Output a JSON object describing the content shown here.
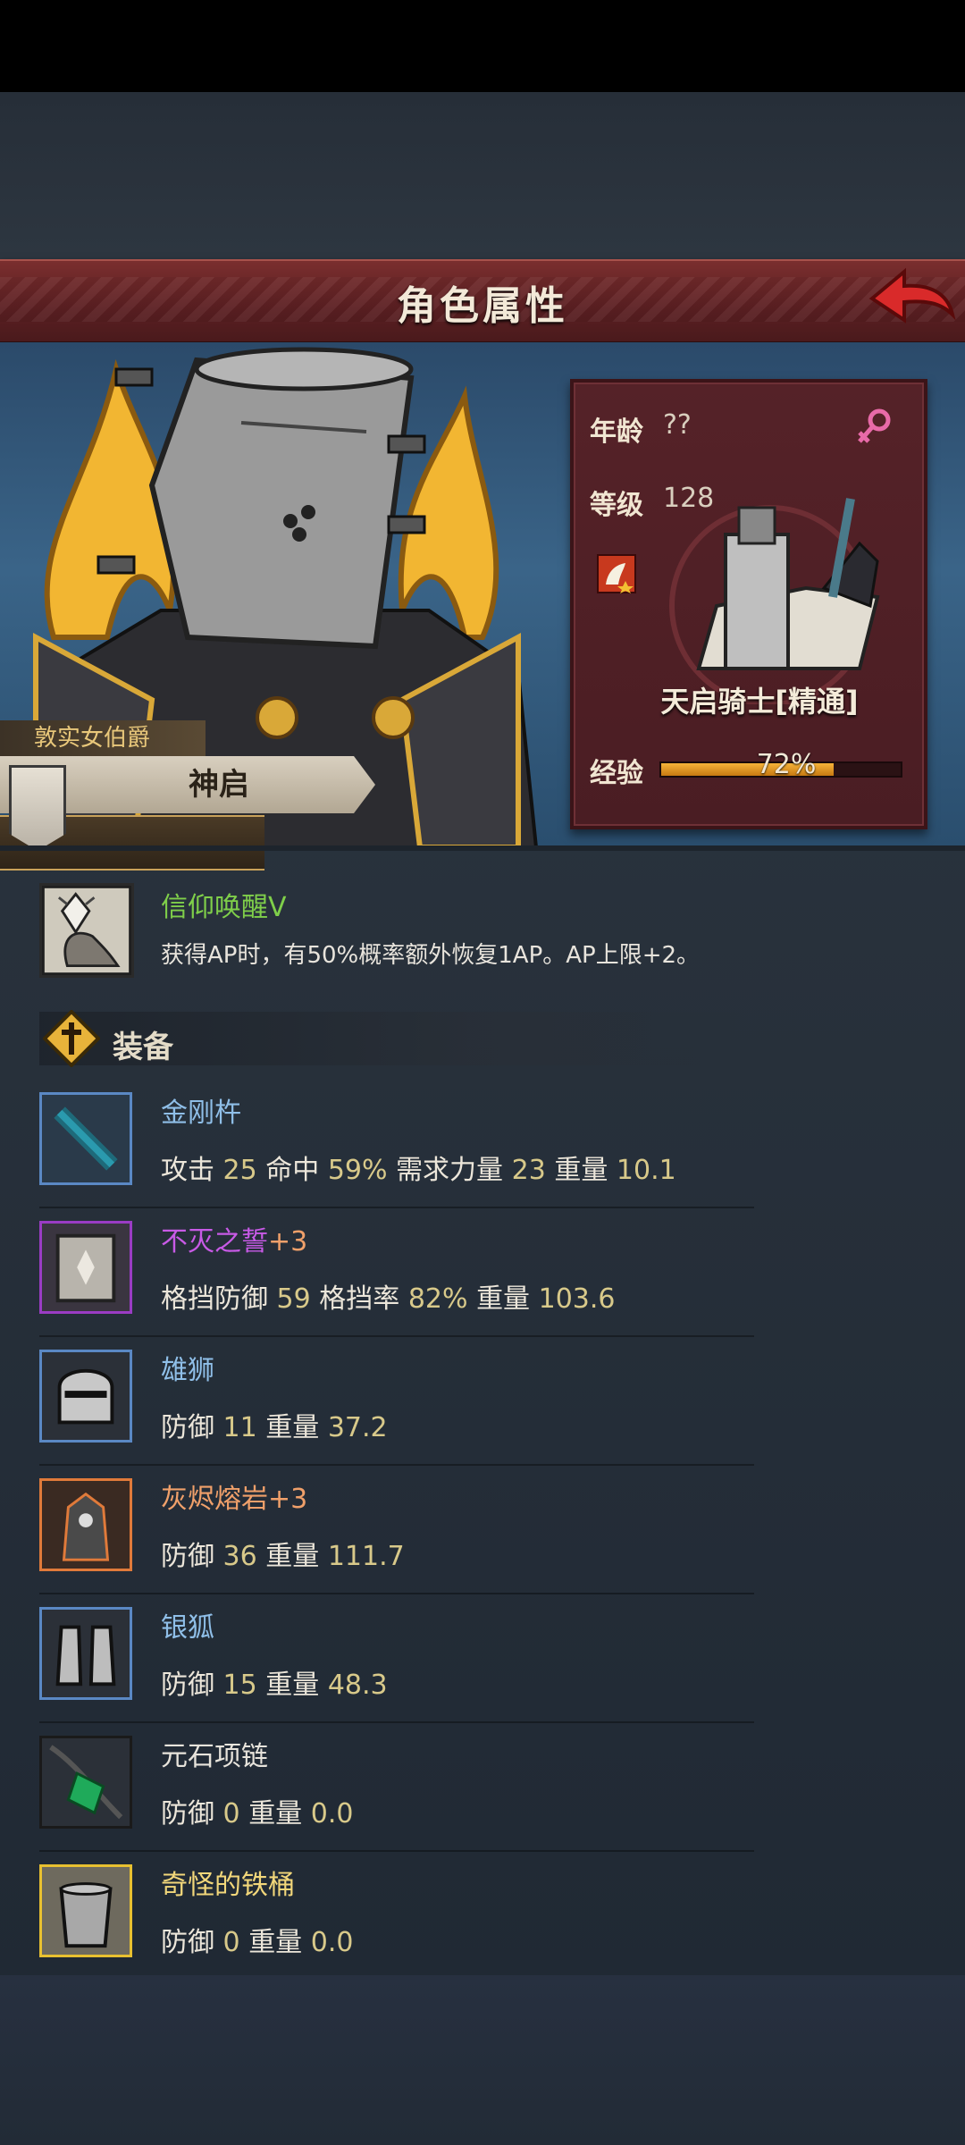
{
  "header": {
    "title": "角色属性",
    "back_icon": "back-arrow-icon"
  },
  "character": {
    "title": "敦实女伯爵",
    "name": "神启",
    "age_label": "年龄",
    "age_value": "??",
    "gender_icon": "female-icon",
    "level_label": "等级",
    "level_value": "128",
    "class_name": "天启骑士[精通]",
    "exp_label": "经验",
    "exp_value": "72%",
    "exp_fraction": 0.72
  },
  "skill": {
    "name": "信仰唤醒V",
    "description": "获得AP时，有50%概率额外恢复1AP。AP上限+2。"
  },
  "equipment_header": "装备",
  "equipment": [
    {
      "name": "金刚杵",
      "name_color": "#8fbfe8",
      "frame_color": "#5a88c4",
      "stats": [
        {
          "k": "攻击",
          "v": "25"
        },
        {
          "k": "命中",
          "v": "59%"
        },
        {
          "k": "需求力量",
          "v": "23"
        },
        {
          "k": "重量",
          "v": "10.1"
        }
      ]
    },
    {
      "name": "不灭之誓",
      "name_suffix": "+3",
      "name_color": "#c85ae6",
      "frame_color": "#9a3cc4",
      "stats": [
        {
          "k": "格挡防御",
          "v": "59"
        },
        {
          "k": "格挡率",
          "v": "82%"
        },
        {
          "k": "重量",
          "v": "103.6"
        }
      ]
    },
    {
      "name": "雄狮",
      "name_color": "#8fbfe8",
      "frame_color": "#5a88c4",
      "stats": [
        {
          "k": "防御",
          "v": "11"
        },
        {
          "k": "重量",
          "v": "37.2"
        }
      ]
    },
    {
      "name": "灰烬熔岩",
      "name_suffix": "+3",
      "name_color": "#f0a06a",
      "frame_color": "#e07a3a",
      "stats": [
        {
          "k": "防御",
          "v": "36"
        },
        {
          "k": "重量",
          "v": "111.7"
        }
      ]
    },
    {
      "name": "银狐",
      "name_color": "#8fbfe8",
      "frame_color": "#5a88c4",
      "stats": [
        {
          "k": "防御",
          "v": "15"
        },
        {
          "k": "重量",
          "v": "48.3"
        }
      ]
    },
    {
      "name": "元石项链",
      "name_color": "#e8e4dc",
      "frame_color": "#1a1a1a",
      "stats": [
        {
          "k": "防御",
          "v": "0"
        },
        {
          "k": "重量",
          "v": "0.0"
        }
      ]
    },
    {
      "name": "奇怪的铁桶",
      "name_color": "#f2d77a",
      "frame_color": "#e8c030",
      "stats": [
        {
          "k": "防御",
          "v": "0"
        },
        {
          "k": "重量",
          "v": "0.0"
        }
      ]
    }
  ]
}
